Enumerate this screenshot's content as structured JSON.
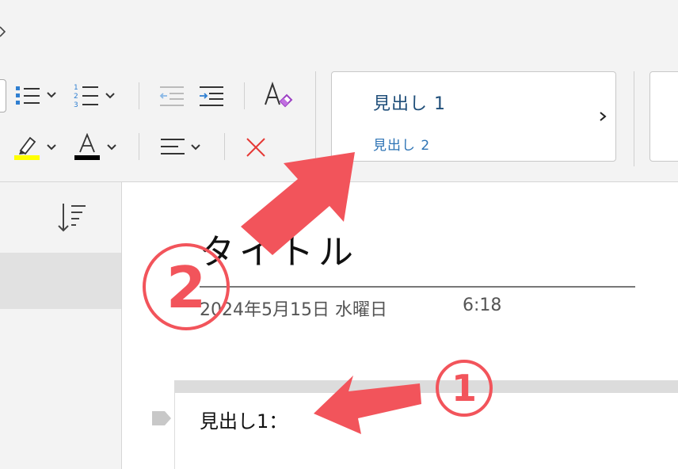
{
  "ribbon": {
    "styles": {
      "heading1": "見出し 1",
      "heading2": "見出し 2"
    }
  },
  "page": {
    "title": "タイトル",
    "date": "2024年5月15日 水曜日",
    "time": "6:18",
    "paragraph": "見出し1："
  },
  "annotations": {
    "marker1": "1",
    "marker2": "2"
  },
  "colors": {
    "annotation_red": "#f2545b",
    "heading1": "#1f4e79",
    "heading2": "#2e74b5",
    "highlight_yellow": "#ffff00",
    "clear_red": "#e53935"
  }
}
